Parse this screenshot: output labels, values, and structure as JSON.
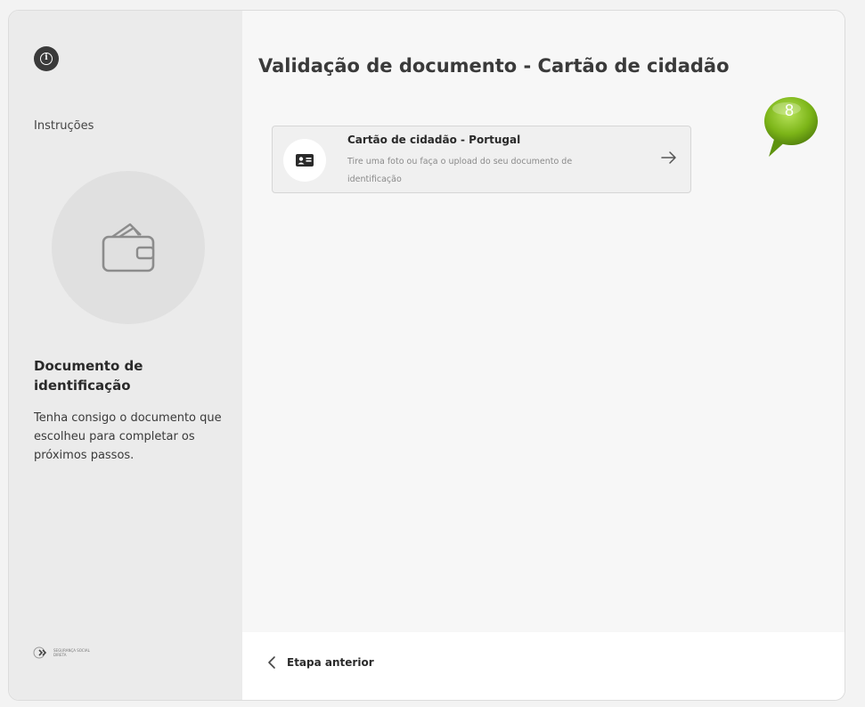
{
  "sidebar": {
    "instructions_label": "Instruções",
    "heading": "Documento de identificação",
    "description": "Tenha consigo o documento que escolheu para completar os próximos passos.",
    "logo_text": "SEGURANÇA SOCIAL DIRETA",
    "info_icon": "info-icon",
    "illustration_icon": "wallet-icon"
  },
  "main": {
    "title": "Validação de documento - Cartão de cidadão",
    "document_option": {
      "title": "Cartão de cidadão - Portugal",
      "description": "Tire uma foto ou faça o upload do seu documento de identificação",
      "icon": "id-card-icon",
      "action_icon": "arrow-right-icon"
    }
  },
  "annotation": {
    "step_number": "8",
    "color": "#7cb518"
  },
  "footer": {
    "back_label": "Etapa anterior",
    "back_icon": "chevron-left-icon"
  }
}
